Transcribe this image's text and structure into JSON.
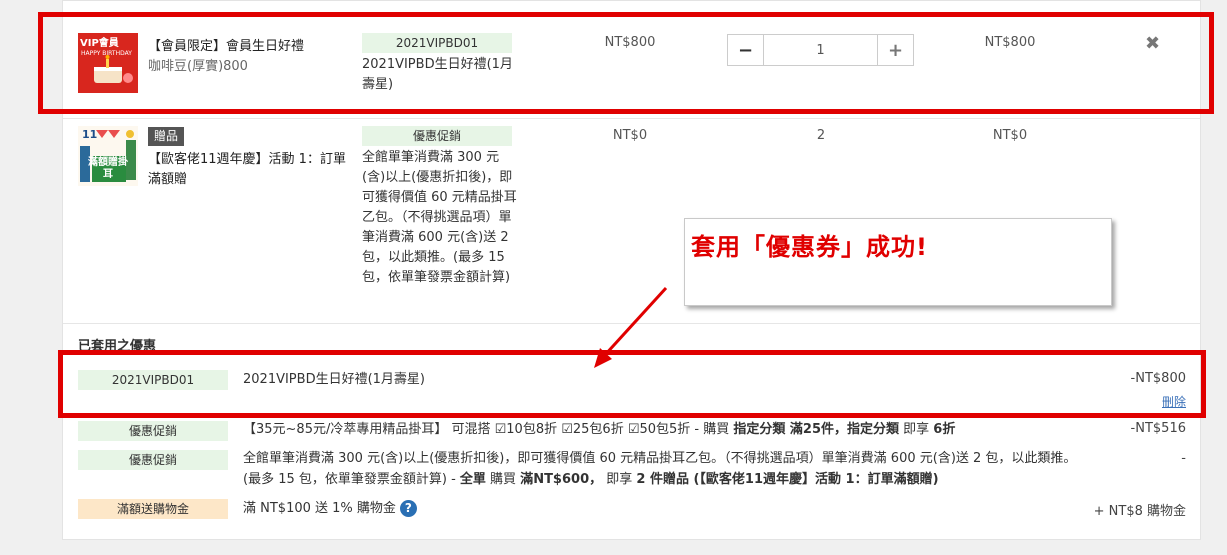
{
  "items": [
    {
      "title": "【會員限定】會員生日好禮",
      "subtitle": "咖啡豆(厚實)800",
      "image_text": "VIP會員",
      "image_subtext": "HAPPY BIRTHDAY",
      "promo_tag": "2021VIPBD01",
      "promo_desc": "2021VIPBD生日好禮(1月壽星)",
      "price": "NT$800",
      "quantity": "1",
      "subtotal": "NT$800"
    },
    {
      "badge": "贈品",
      "title": "【歐客佬11週年慶】活動 1：訂單滿額贈",
      "image_text": "滿額贈掛耳",
      "image_num": "11",
      "promo_tag": "優惠促銷",
      "promo_desc": "全館單筆消費滿 300 元(含)以上(優惠折扣後)，即可獲得價值 60 元精品掛耳乙包。（不得挑選品項）單筆消費滿 600 元(含)送 2 包，以此類推。(最多 15 包，依單筆發票金額計算)",
      "price": "NT$0",
      "quantity": "2",
      "subtotal": "NT$0"
    }
  ],
  "callout": {
    "text": "套用「優惠券」成功!"
  },
  "applied_section": {
    "heading": "已套用之優惠",
    "coupon": {
      "tag": "2021VIPBD01",
      "desc": "2021VIPBD生日好禮(1月壽星)",
      "amount": "-NT$800",
      "delete_label": "刪除"
    },
    "promos": [
      {
        "tag": "優惠促銷",
        "desc_a": "【35元~85元/冷萃專用精品掛耳】 可混搭 ☑10包8折 ☑25包6折 ☑50包5折 - 購買 ",
        "desc_b": "指定分類 滿25件，指定分類",
        "desc_c": " 即享 ",
        "desc_d": "6折",
        "amount": "-NT$516"
      },
      {
        "tag": "優惠促銷",
        "desc_a": "全館單筆消費滿 300 元(含)以上(優惠折扣後)，即可獲得價值 60 元精品掛耳乙包。（不得挑選品項）單筆消費滿 600 元(含)送 2 包，以此類推。(最多 15 包，依單筆發票金額計算) - ",
        "desc_b": "全單",
        "desc_c": " 購買 ",
        "desc_d": "滿NT$600，",
        "desc_e": " 即享 ",
        "desc_f": "2 件贈品 (【歐客佬11週年慶】活動 1：訂單滿額贈)",
        "amount": "-"
      },
      {
        "tag": "滿額送購物金",
        "desc_a": "滿 NT$100 送 1% 購物金",
        "amount": "+ NT$8 購物金"
      }
    ]
  },
  "colors": {
    "highlight_red": "#e00000",
    "tag_green": "#e7f5e6",
    "tag_orange": "#fde7c8",
    "link_blue": "#3a70b8"
  }
}
